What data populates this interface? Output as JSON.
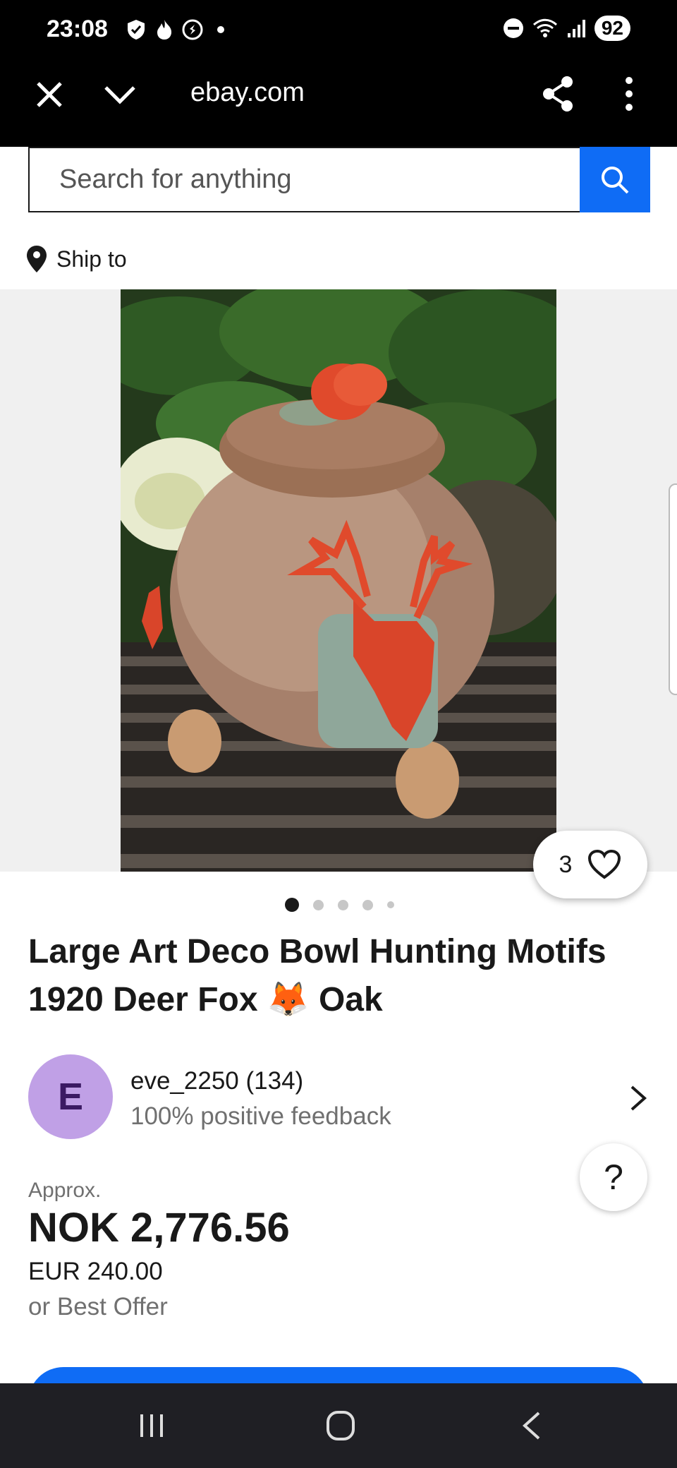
{
  "status_bar": {
    "time": "23:08",
    "battery": "92",
    "icons": [
      "shield-icon",
      "flame-icon",
      "shazam-icon",
      "dnd-icon",
      "wifi-icon",
      "signal-icon"
    ]
  },
  "browser": {
    "url": "ebay.com",
    "icons": [
      "close-icon",
      "chevron-down-icon",
      "share-icon",
      "more-vert-icon"
    ]
  },
  "search": {
    "placeholder": "Search for anything"
  },
  "ship_to": {
    "label": "Ship to"
  },
  "gallery": {
    "like_count": "3",
    "dot_count": 5,
    "active_index": 0
  },
  "listing": {
    "title": "Large Art Deco Bowl Hunting Motifs 1920 Deer Fox 🦊 Oak"
  },
  "seller": {
    "initial": "E",
    "name": "eve_2250 (134)",
    "feedback": "100% positive feedback"
  },
  "help": {
    "label": "?"
  },
  "price": {
    "approx_label": "Approx.",
    "main": "NOK 2,776.56",
    "eur": "EUR 240.00",
    "best_offer": "or Best Offer"
  },
  "colors": {
    "accent": "#0f6cf5",
    "avatar_bg": "#c0a0e6",
    "avatar_fg": "#3b1a63",
    "nav_bg": "#1f1f24"
  }
}
